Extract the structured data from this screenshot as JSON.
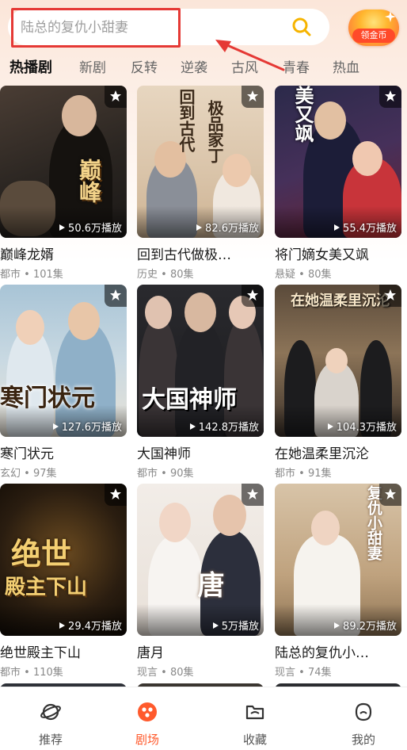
{
  "search": {
    "placeholder": "陆总的复仇小甜妻"
  },
  "coin": {
    "label": "领金币"
  },
  "tabs": [
    {
      "label": "热播剧",
      "active": true
    },
    {
      "label": "新剧"
    },
    {
      "label": "反转"
    },
    {
      "label": "逆袭"
    },
    {
      "label": "古风"
    },
    {
      "label": "青春"
    },
    {
      "label": "热血"
    }
  ],
  "cards": [
    {
      "title": "巅峰龙婿",
      "genre": "都市",
      "episodes": "101集",
      "plays": "50.6万播放",
      "art": "巅峰龙婿",
      "theme": "dark-dragon"
    },
    {
      "title": "回到古代做极…",
      "genre": "历史",
      "episodes": "80集",
      "plays": "82.6万播放",
      "art": "回到古代做极品家丁",
      "theme": "ancient"
    },
    {
      "title": "将门嫡女美又飒",
      "genre": "悬疑",
      "episodes": "80集",
      "plays": "55.4万播放",
      "art": "美又飒",
      "theme": "general"
    },
    {
      "title": "寒门状元",
      "genre": "玄幻",
      "episodes": "97集",
      "plays": "127.6万播放",
      "art": "寒门状元",
      "theme": "scholar"
    },
    {
      "title": "大国神师",
      "genre": "都市",
      "episodes": "90集",
      "plays": "142.8万播放",
      "art": "大国神师",
      "theme": "group"
    },
    {
      "title": "在她温柔里沉沦",
      "genre": "都市",
      "episodes": "91集",
      "plays": "104.3万播放",
      "art": "在她温柔里沉沦",
      "theme": "palace"
    },
    {
      "title": "绝世殿主下山",
      "genre": "都市",
      "episodes": "110集",
      "plays": "29.4万播放",
      "art": "绝世殿主下山",
      "theme": "gold"
    },
    {
      "title": "唐月",
      "genre": "现言",
      "episodes": "80集",
      "plays": "5万播放",
      "art": "唐",
      "theme": "couple"
    },
    {
      "title": "陆总的复仇小…",
      "genre": "现言",
      "episodes": "74集",
      "plays": "89.2万播放",
      "art": "陆总的复仇小甜妻",
      "theme": "bride"
    }
  ],
  "meta_separator": "•",
  "nav": [
    {
      "label": "推荐",
      "icon": "planet-icon"
    },
    {
      "label": "剧场",
      "icon": "theater-icon",
      "active": true
    },
    {
      "label": "收藏",
      "icon": "folder-icon"
    },
    {
      "label": "我的",
      "icon": "profile-icon"
    }
  ],
  "colors": {
    "accent": "#ff5a2c",
    "highlight": "#e53935",
    "search_icon": "#f6b400"
  }
}
